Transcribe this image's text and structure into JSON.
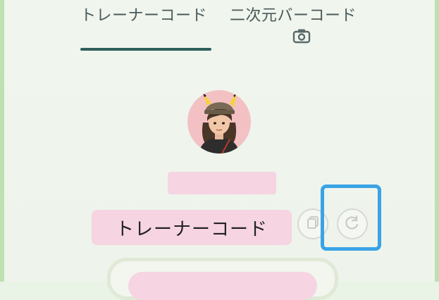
{
  "tabs": [
    {
      "label": "トレーナーコード",
      "active": true
    },
    {
      "label": "二次元バーコード",
      "active": false
    }
  ],
  "trainer_code": {
    "label": "トレーナーコード"
  },
  "icons": {
    "camera": "camera-icon",
    "copy": "copy-icon",
    "refresh": "refresh-icon"
  },
  "colors": {
    "accent_indicator": "#2f5f5c",
    "highlight": "#3aa3e6",
    "pill_bg": "#f6d4e2",
    "panel_border": "#bfe0b2"
  }
}
